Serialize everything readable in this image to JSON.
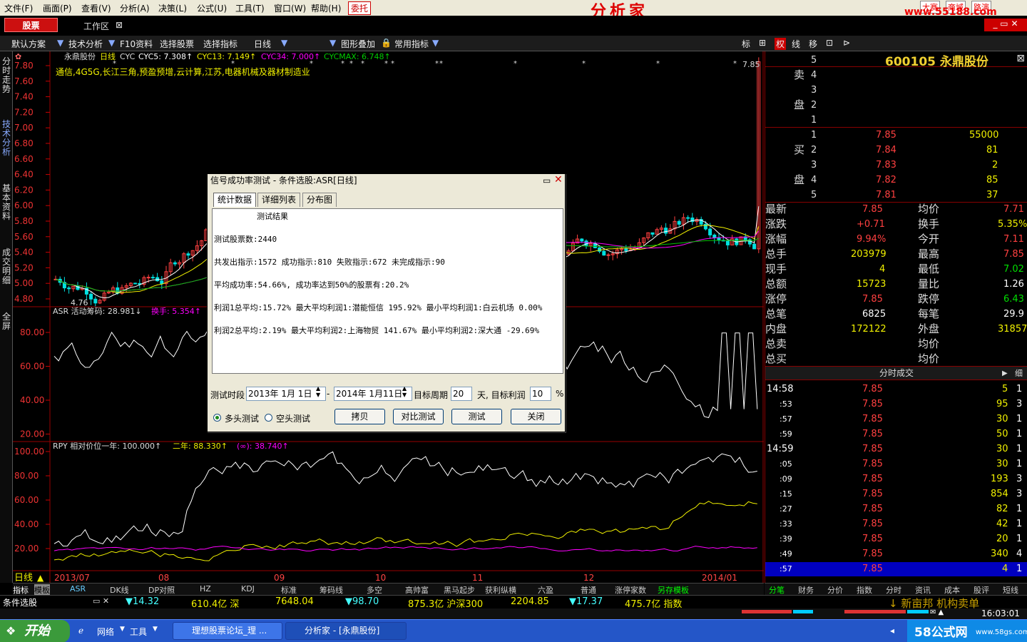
{
  "menu": {
    "items": [
      "文件(F)",
      "画面(P)",
      "查看(V)",
      "分析(A)",
      "决策(L)",
      "公式(U)",
      "工具(T)",
      "窗口(W)",
      "帮助(H)"
    ],
    "entrust": "委托",
    "brand": "分析家",
    "site": "www.55188.com",
    "site_links": [
      "大赛",
      "商城",
      "路演"
    ]
  },
  "top": {
    "stock_button": "股票",
    "workspace": "工作区"
  },
  "toolbar": {
    "items": [
      "默认方案",
      "技术分析",
      "F10资料",
      "选择股票",
      "选择指标",
      "日线",
      "图形叠加",
      "常用指标"
    ],
    "right": [
      "标",
      "权",
      "线",
      "移"
    ]
  },
  "left_tabs": [
    "分时走势",
    "技术分析",
    "基本资料",
    "成交明细",
    "全屏"
  ],
  "chart": {
    "header": {
      "name": "永鼎股份",
      "period": "日线",
      "indicator": "CYC",
      "cyc5": "CYC5: 7.308↑",
      "cyc13": "CYC13: 7.149↑",
      "cyc34": "CYC34: 7.000↑",
      "cycmax": "CYCMAX: 6.748↑"
    },
    "concepts": "通信,4G5G,长江三角,预盈预增,云计算,江苏,电器机械及器材制造业",
    "price_ticks": [
      "7.80",
      "7.60",
      "7.40",
      "7.20",
      "7.00",
      "6.80",
      "6.60",
      "6.40",
      "6.20",
      "6.00",
      "5.80",
      "5.60",
      "5.40",
      "5.20",
      "5.00",
      "4.80"
    ],
    "high_mark": "7.85",
    "low_mark": "4.76",
    "asr_header": {
      "name": "ASR 活动筹码: 28.981↓",
      "swap": "换手: 5.354↑"
    },
    "asr_ticks": [
      "80.00",
      "60.00",
      "40.00",
      "20.00"
    ],
    "rpy_header": {
      "name": "RPY 相对价位一年: 100.000↑",
      "two": "二年: 88.330↑",
      "inf": "(∞): 38.740↑"
    },
    "rpy_ticks": [
      "100.00",
      "80.00",
      "60.00",
      "40.00",
      "20.00"
    ],
    "date_label": "日线",
    "dates": [
      "2013/07",
      "08",
      "09",
      "10",
      "11",
      "12",
      "2014/01"
    ]
  },
  "dialog": {
    "title": "信号成功率测试 - 条件选股:ASR[日线]",
    "tabs": [
      "统计数据",
      "详细列表",
      "分布图"
    ],
    "lines": [
      "测试结果",
      "测试股票数:2440",
      "共发出指示:1572 成功指示:810 失败指示:672 未完成指示:90",
      "平均成功率:54.66%, 成功率达到50%的股票有:20.2%",
      "利润1总平均:15.72% 最大平均利润1:潜能恒信 195.92% 最小平均利润1:白云机场 0.00%",
      "利润2总平均:2.19% 最大平均利润2:上海物贸 141.67% 最小平均利润2:深大通  -29.69%"
    ],
    "period_label": "测试时段",
    "date_from": "2013年 1月 1日",
    "dash": "-",
    "date_to": "2014年 1月11日",
    "target_period_label": "目标周期",
    "target_period": "20",
    "days_label": "天, 目标利润",
    "target_profit": "10",
    "pct": "%",
    "long_test": "多头测试",
    "short_test": "空头测试",
    "buttons": [
      "拷贝",
      "对比测试",
      "测试",
      "关闭"
    ]
  },
  "quote": {
    "code": "600105 永鼎股份",
    "sell": [
      {
        "n": "5",
        "p": "",
        "v": ""
      },
      {
        "n": "4",
        "p": "",
        "v": ""
      },
      {
        "n": "3",
        "p": "",
        "v": ""
      },
      {
        "n": "2",
        "p": "",
        "v": ""
      },
      {
        "n": "1",
        "p": "",
        "v": ""
      }
    ],
    "sell_label": [
      "卖",
      "盘"
    ],
    "buy_label": [
      "买",
      "盘"
    ],
    "buy": [
      {
        "n": "1",
        "p": "7.85",
        "v": "55000"
      },
      {
        "n": "2",
        "p": "7.84",
        "v": "81"
      },
      {
        "n": "3",
        "p": "7.83",
        "v": "2"
      },
      {
        "n": "4",
        "p": "7.82",
        "v": "85"
      },
      {
        "n": "5",
        "p": "7.81",
        "v": "37"
      }
    ],
    "stats": [
      {
        "l1": "最新",
        "v1": "7.85",
        "l2": "均价",
        "v2": "7.71"
      },
      {
        "l1": "涨跌",
        "v1": "+0.71",
        "l2": "换手",
        "v2": "5.35%"
      },
      {
        "l1": "涨幅",
        "v1": "9.94%",
        "l2": "今开",
        "v2": "7.11"
      },
      {
        "l1": "总手",
        "v1": "203979",
        "l2": "最高",
        "v2": "7.85"
      },
      {
        "l1": "现手",
        "v1": "4",
        "l2": "最低",
        "v2": "7.02"
      },
      {
        "l1": "总额",
        "v1": "15723",
        "l2": "量比",
        "v2": "1.26"
      },
      {
        "l1": "涨停",
        "v1": "7.85",
        "l2": "跌停",
        "v2": "6.43"
      },
      {
        "l1": "总笔",
        "v1": "6825",
        "l2": "每笔",
        "v2": "29.9"
      },
      {
        "l1": "内盘",
        "v1": "172122",
        "l2": "外盘",
        "v2": "31857"
      },
      {
        "l1": "总卖",
        "v1": "",
        "l2": "均价",
        "v2": ""
      },
      {
        "l1": "总买",
        "v1": "",
        "l2": "均价",
        "v2": ""
      }
    ],
    "ticks_header": "分时成交",
    "ticks_toggle": "细",
    "ticks": [
      {
        "t": "14:58",
        "p": "7.85",
        "v": "5",
        "n": "1"
      },
      {
        "t": ":53",
        "p": "7.85",
        "v": "95",
        "n": "3"
      },
      {
        "t": ":57",
        "p": "7.85",
        "v": "30",
        "n": "1"
      },
      {
        "t": ":59",
        "p": "7.85",
        "v": "50",
        "n": "1"
      },
      {
        "t": "14:59",
        "p": "7.85",
        "v": "30",
        "n": "1"
      },
      {
        "t": ":05",
        "p": "7.85",
        "v": "30",
        "n": "1"
      },
      {
        "t": ":09",
        "p": "7.85",
        "v": "193",
        "n": "3"
      },
      {
        "t": ":15",
        "p": "7.85",
        "v": "854",
        "n": "3"
      },
      {
        "t": ":27",
        "p": "7.85",
        "v": "82",
        "n": "1"
      },
      {
        "t": ":33",
        "p": "7.85",
        "v": "42",
        "n": "1"
      },
      {
        "t": ":39",
        "p": "7.85",
        "v": "20",
        "n": "1"
      },
      {
        "t": ":49",
        "p": "7.85",
        "v": "340",
        "n": "4"
      },
      {
        "t": ":57",
        "p": "7.85",
        "v": "4",
        "n": "1"
      }
    ]
  },
  "bottom_tabs": [
    "指标",
    "模板",
    "ASR",
    "DK线",
    "DP对照",
    "HZ",
    "KDJ",
    "标准",
    "筹码线",
    "多空",
    "高帅富",
    "黑马起步",
    "获利纵横",
    "六盈",
    "普通",
    "涨停家数",
    "另存模板"
  ],
  "right_tabs": [
    "分笔",
    "财务",
    "分价",
    "指数",
    "分时",
    "资讯",
    "成本",
    "股评",
    "短线"
  ],
  "ticker": {
    "panel": "条件选股",
    "items": [
      "▼14.32",
      "610.4亿 深",
      "7648.04",
      "▼98.70",
      "875.3亿 沪深300",
      "2204.85",
      "▼17.37",
      "475.7亿 指数"
    ],
    "news": "↓ 新亩邦 机构卖单",
    "time": "16:03:01"
  },
  "taskbar": {
    "start": "开始",
    "quick": [
      "网络",
      "工具"
    ],
    "tasks": [
      "理想股票论坛_理 ...",
      "分析家 - [永鼎股份]"
    ],
    "tray": "58公式网",
    "tray_url": "www.58gs.com"
  }
}
